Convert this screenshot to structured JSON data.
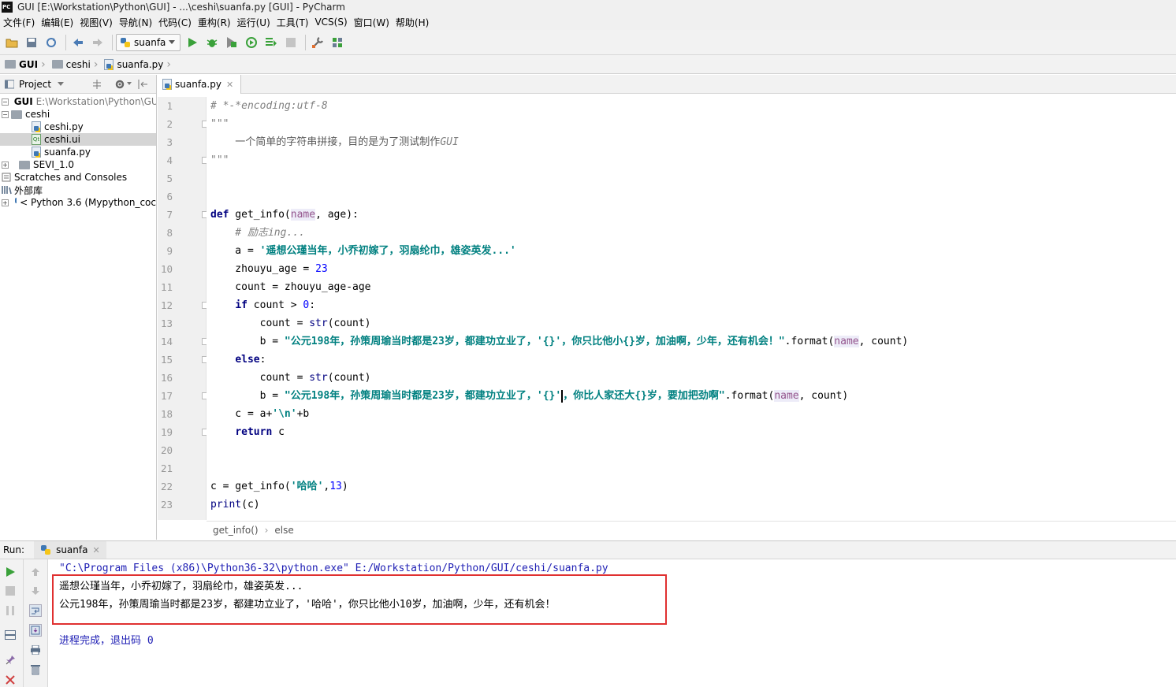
{
  "window": {
    "title": "GUI [E:\\Workstation\\Python\\GUI] - ...\\ceshi\\suanfa.py [GUI] - PyCharm",
    "logo": "PC"
  },
  "menu": [
    "文件(F)",
    "编辑(E)",
    "视图(V)",
    "导航(N)",
    "代码(C)",
    "重构(R)",
    "运行(U)",
    "工具(T)",
    "VCS(S)",
    "窗口(W)",
    "帮助(H)"
  ],
  "toolbar": {
    "run_config": "suanfa"
  },
  "breadcrumb": [
    "GUI",
    "ceshi",
    "suanfa.py"
  ],
  "project": {
    "header": "Project",
    "tree": [
      {
        "label": "GUI",
        "extra": "E:\\Workstation\\Python\\GU"
      },
      {
        "label": "ceshi"
      },
      {
        "label": "ceshi.py"
      },
      {
        "label": "ceshi.ui"
      },
      {
        "label": "suanfa.py"
      },
      {
        "label": "SEVI_1.0"
      },
      {
        "label": "Scratches and Consoles"
      },
      {
        "label": "外部库"
      },
      {
        "label": "< Python 3.6 (Mypython_coc"
      }
    ]
  },
  "editor": {
    "tab": "suanfa.py",
    "line_numbers": [
      "1",
      "2",
      "3",
      "4",
      "5",
      "6",
      "7",
      "8",
      "9",
      "10",
      "11",
      "12",
      "13",
      "14",
      "15",
      "16",
      "17",
      "18",
      "19",
      "20",
      "21",
      "22",
      "23"
    ],
    "code": {
      "l1": "# *-*encoding:utf-8",
      "l2": "\"\"\"",
      "l3a": "    一个简单的字符串拼接，目的是为了测试制作",
      "l3b": "GUI",
      "l4": "\"\"\"",
      "def": "def",
      "fn_name": " get_info(",
      "p_name": "name",
      "p_rest": ", age):",
      "l8": "    # 励志ing...",
      "l9a": "    a = ",
      "l9s": "'遥想公瑾当年，小乔初嫁了，羽扇纶巾，雄姿英发...'",
      "l10a": "    zhouyu_age = ",
      "l10n": "23",
      "l11": "    count = zhouyu_age-age",
      "l12k": "if",
      "l12a": " count > ",
      "l12n": "0",
      "l12b": ":",
      "l13a": "        count = ",
      "l13f": "str",
      "l13b": "(count)",
      "l14a": "        b = ",
      "l14s": "\"公元198年，孙策周瑜当时都是23岁，都建功立业了，'{}'，你只比他小{}岁，加油啊，少年，还有机会！\"",
      "l14b": ".format(",
      "l14p": "name",
      "l14c": ", count)",
      "l15k": "else",
      "l15b": ":",
      "l16a": "        count = ",
      "l16f": "str",
      "l16b": "(count)",
      "l17a": "        b = ",
      "l17s1": "\"公元198年，孙策周瑜当时都是23岁，都建功立业了，'{}'",
      "l17s2": "，你比人家还大{}岁，要加把劲啊\"",
      "l17b": ".format(",
      "l17p": "name",
      "l17c": ", count)",
      "l18a": "    c = a+",
      "l18s": "'\\n'",
      "l18b": "+b",
      "l19k": "return",
      "l19a": " c",
      "l22a": "c = get_info(",
      "l22s": "'哈哈'",
      "l22b": ",",
      "l22n": "13",
      "l22c": ")",
      "l23f": "print",
      "l23a": "(c)"
    },
    "crumbs": [
      "get_info()",
      "else"
    ]
  },
  "run": {
    "label": "Run:",
    "tab": "suanfa",
    "command": "\"C:\\Program Files (x86)\\Python36-32\\python.exe\" E:/Workstation/Python/GUI/ceshi/suanfa.py",
    "output": [
      "遥想公瑾当年，小乔初嫁了，羽扇纶巾，雄姿英发...",
      "公元198年，孙策周瑜当时都是23岁，都建功立业了，'哈哈'，你只比他小10岁，加油啊，少年，还有机会！"
    ],
    "exit": "进程完成，退出码 0"
  },
  "colors": {
    "keyword": "#000080",
    "string": "#008080",
    "number": "#0000ff",
    "comment": "#808080",
    "highlight_line": "#fffae3",
    "annotation_box": "#e03030"
  }
}
